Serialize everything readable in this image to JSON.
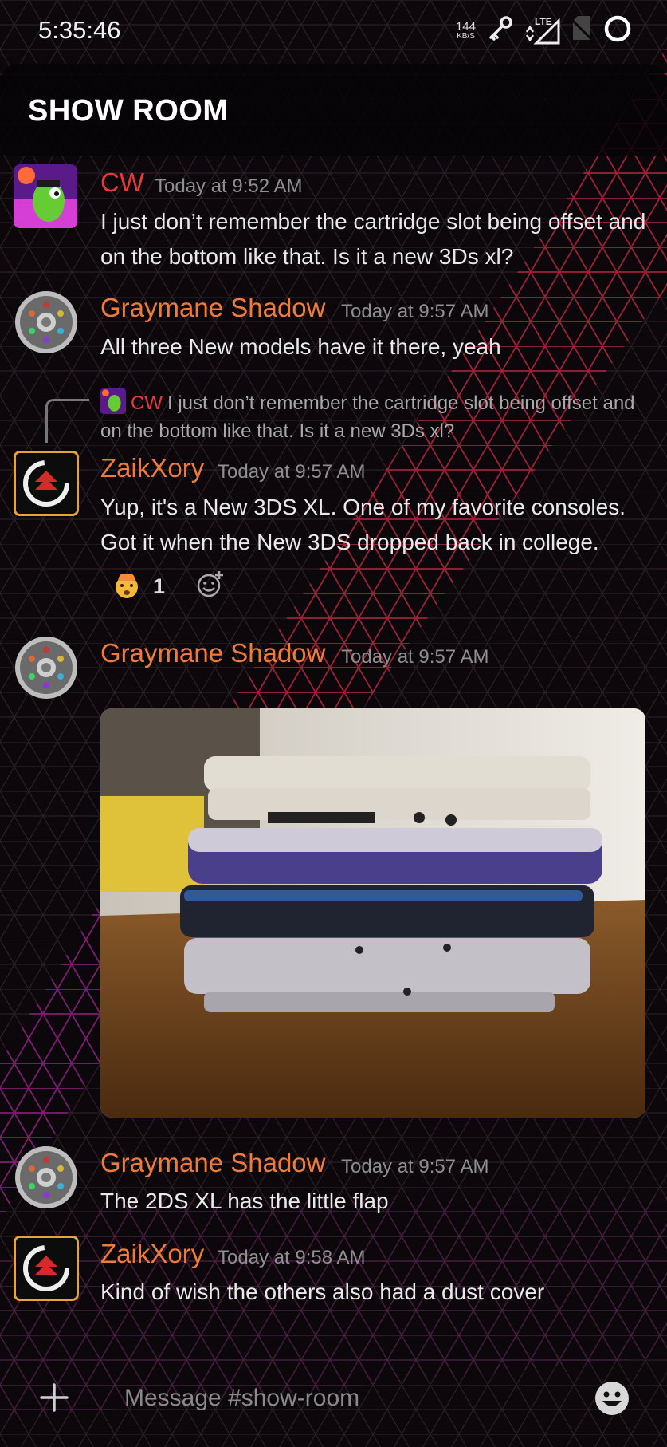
{
  "status_bar": {
    "time": "5:35:46",
    "net_speed_value": "144",
    "net_speed_unit": "KB/S",
    "network_label": "LTE",
    "icons": [
      "key-icon",
      "lte-signal-icon",
      "no-sim-icon",
      "battery-ring-icon"
    ]
  },
  "channel": {
    "title": "SHOW ROOM"
  },
  "messages": [
    {
      "author": "CW",
      "author_color": "#e83a3a",
      "time": "Today at 9:52 AM",
      "text": "I just don’t remember the cartridge slot being offset and on the bottom like that. Is it a new 3Ds xl?"
    },
    {
      "author": "Graymane Shadow",
      "author_color": "#ef7b3a",
      "time": "Today at 9:57 AM",
      "text": "All three New models have it there, yeah"
    },
    {
      "reply_to": {
        "author": "CW",
        "text": "I just don’t remember the cartridge slot being offset and on the bottom like that. Is it a new 3Ds xl?"
      },
      "author": "ZaikXory",
      "author_color": "#ef7b3a",
      "time": "Today at 9:57 AM",
      "text": "Yup, it's a New 3DS XL. One of my favorite consoles. Got it when the New 3DS dropped back in college.",
      "reaction": {
        "emoji": "🤯",
        "count": "1"
      }
    },
    {
      "author": "Graymane Shadow",
      "author_color": "#ef7b3a",
      "time": "Today at 9:57 AM",
      "attachment": "image"
    },
    {
      "author": "Graymane Shadow",
      "author_color": "#ef7b3a",
      "time": "Today at 9:57 AM",
      "text": "The 2DS XL has the little flap"
    },
    {
      "author": "ZaikXory",
      "author_color": "#ef7b3a",
      "time": "Today at 9:58 AM",
      "text": "Kind of wish the others also had a dust cover"
    }
  ],
  "composer": {
    "placeholder": "Message #show-room",
    "icons": [
      "plus-icon",
      "emoji-icon"
    ]
  },
  "colors": {
    "background": "#0c070b",
    "accent_orange": "#ef7b3a",
    "accent_red": "#e83a3a",
    "timestamp": "#8f8f8f"
  }
}
